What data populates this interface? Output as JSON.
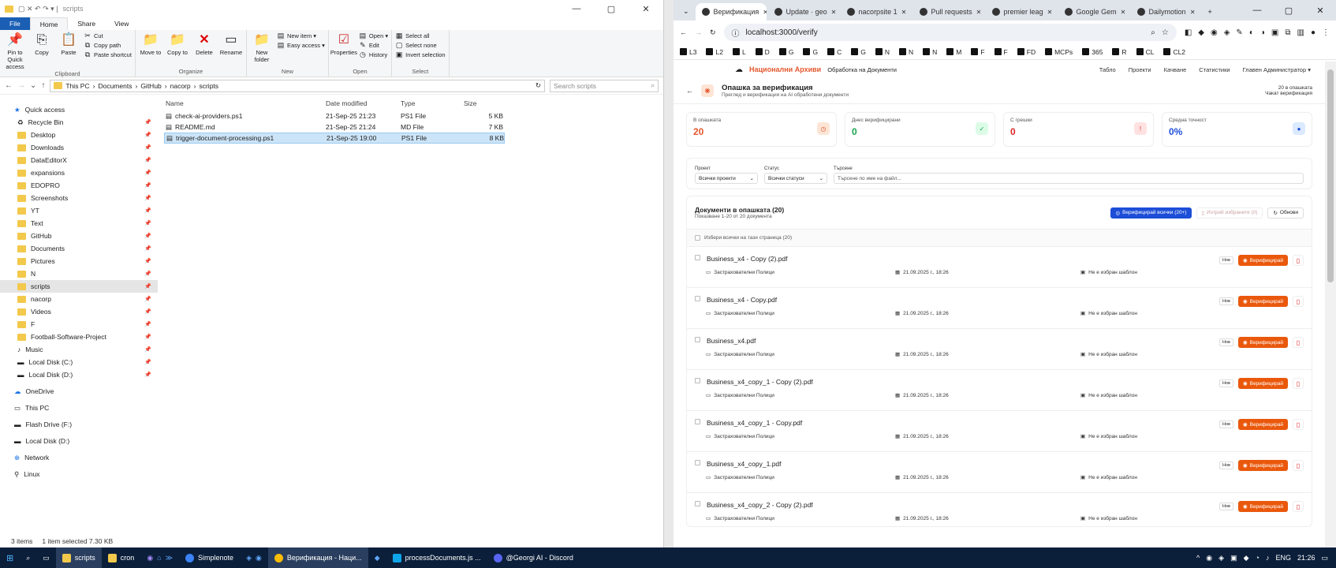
{
  "explorer": {
    "title": "scripts",
    "ribbon_tabs": [
      "File",
      "Home",
      "Share",
      "View"
    ],
    "clipboard": {
      "pin": "Pin to Quick access",
      "copy": "Copy",
      "paste": "Paste",
      "cut": "Cut",
      "copy_path": "Copy path",
      "paste_shortcut": "Paste shortcut",
      "group": "Clipboard"
    },
    "organize": {
      "move_to": "Move to",
      "copy_to": "Copy to",
      "delete": "Delete",
      "rename": "Rename",
      "group": "Organize"
    },
    "new": {
      "new_folder": "New folder",
      "new_item": "New item ▾",
      "easy_access": "Easy access ▾",
      "group": "New"
    },
    "open": {
      "properties": "Properties",
      "open": "Open ▾",
      "edit": "Edit",
      "history": "History",
      "group": "Open"
    },
    "select": {
      "select_all": "Select all",
      "select_none": "Select none",
      "invert": "Invert selection",
      "group": "Select"
    },
    "breadcrumb": [
      "This PC",
      "Documents",
      "GitHub",
      "nacorp",
      "scripts"
    ],
    "search_placeholder": "Search scripts",
    "columns": {
      "name": "Name",
      "date": "Date modified",
      "type": "Type",
      "size": "Size"
    },
    "files": [
      {
        "name": "check-ai-providers.ps1",
        "date": "21-Sep-25 21:23",
        "type": "PS1 File",
        "size": "5 KB"
      },
      {
        "name": "README.md",
        "date": "21-Sep-25 21:24",
        "type": "MD File",
        "size": "7 KB"
      },
      {
        "name": "trigger-document-processing.ps1",
        "date": "21-Sep-25 19:00",
        "type": "PS1 File",
        "size": "8 KB"
      }
    ],
    "nav": {
      "quick_access": "Quick access",
      "quick_items": [
        "Recycle Bin",
        "Desktop",
        "Downloads",
        "DataEditorX",
        "expansions",
        "EDOPRO",
        "Screenshots",
        "YT",
        "Text",
        "GitHub",
        "Documents",
        "Pictures",
        "N",
        "scripts",
        "nacorp",
        "Videos",
        "F",
        "Football-Software-Project",
        "Music",
        "Local Disk (C:)",
        "Local Disk (D:)"
      ],
      "roots": [
        "OneDrive",
        "This PC",
        "Flash Drive (F:)",
        "Local Disk (D:)",
        "Network",
        "Linux"
      ]
    },
    "status": {
      "items": "3 items",
      "selected": "1 item selected  7.30 KB"
    }
  },
  "chrome": {
    "tabs": [
      "Верификация",
      "Update · geo",
      "nacorpsite 1",
      "Pull requests",
      "premier leag",
      "Google Gem",
      "Dailymotion"
    ],
    "url": "localhost:3000/verify",
    "bookmarks": [
      "L3",
      "L2",
      "L",
      "D",
      "G",
      "G",
      "C",
      "G",
      "N",
      "N",
      "N",
      "M",
      "F",
      "F",
      "FD",
      "MCPs",
      "365",
      "R",
      "CL",
      "CL2"
    ]
  },
  "app": {
    "brand": "Национални Архиви",
    "brand_sub": "Обработка на Документи",
    "nav_links": [
      "Табло",
      "Проекти",
      "Качване",
      "Статистики",
      "Главен Администратор ▾"
    ],
    "page_title": "Опашка за верификация",
    "page_sub": "Преглед и верификация на AI обработени документи",
    "queue_count": "20 в опашката",
    "queue_sub": "Чакат верификация",
    "stats": [
      {
        "label": "В опашката",
        "value": "20",
        "color": "#e4572e"
      },
      {
        "label": "Днес верифицирани",
        "value": "0",
        "color": "#16a34a"
      },
      {
        "label": "С грешки",
        "value": "0",
        "color": "#dc2626"
      },
      {
        "label": "Средна точност",
        "value": "0%",
        "color": "#1d4ed8"
      }
    ],
    "filters": {
      "project_label": "Проект",
      "project_value": "Всички проекти",
      "status_label": "Статус",
      "status_value": "Всички статуси",
      "search_label": "Търсене",
      "search_placeholder": "Търсене по име на файл..."
    },
    "docs_title": "Документи в опашката (20)",
    "docs_sub": "Показване 1-20 от 20 документа",
    "verify_all": "Верифицирай всички (20+)",
    "verify_selected": "Изтрий избраните (0)",
    "refresh": "Обнови",
    "select_all_page": "Избери всички на тази страница (20)",
    "badge": "Нов",
    "verify_btn": "Верифицирай",
    "documents": [
      {
        "name": "Business_x4 - Copy (2).pdf",
        "category": "Застрахователни Полици",
        "date": "21.09.2025 г., 18:26",
        "template": "Не е избран шаблон"
      },
      {
        "name": "Business_x4 - Copy.pdf",
        "category": "Застрахователни Полици",
        "date": "21.09.2025 г., 18:26",
        "template": "Не е избран шаблон"
      },
      {
        "name": "Business_x4.pdf",
        "category": "Застрахователни Полици",
        "date": "21.09.2025 г., 18:26",
        "template": "Не е избран шаблон"
      },
      {
        "name": "Business_x4_copy_1 - Copy (2).pdf",
        "category": "Застрахователни Полици",
        "date": "21.09.2025 г., 18:26",
        "template": "Не е избран шаблон"
      },
      {
        "name": "Business_x4_copy_1 - Copy.pdf",
        "category": "Застрахователни Полици",
        "date": "21.09.2025 г., 18:26",
        "template": "Не е избран шаблон"
      },
      {
        "name": "Business_x4_copy_1.pdf",
        "category": "Застрахователни Полици",
        "date": "21.09.2025 г., 18:26",
        "template": "Не е избран шаблон"
      },
      {
        "name": "Business_x4_copy_2 - Copy (2).pdf",
        "category": "Застрахователни Полици",
        "date": "21.09.2025 г., 18:26",
        "template": "Не е избран шаблон"
      }
    ]
  },
  "taskbar": {
    "items": [
      "scripts",
      "cron",
      "Simplenote",
      "Верификация - Наци...",
      "processDocuments.js ...",
      "@Georgi AI - Discord"
    ],
    "lang": "ENG",
    "time": "21:26"
  }
}
